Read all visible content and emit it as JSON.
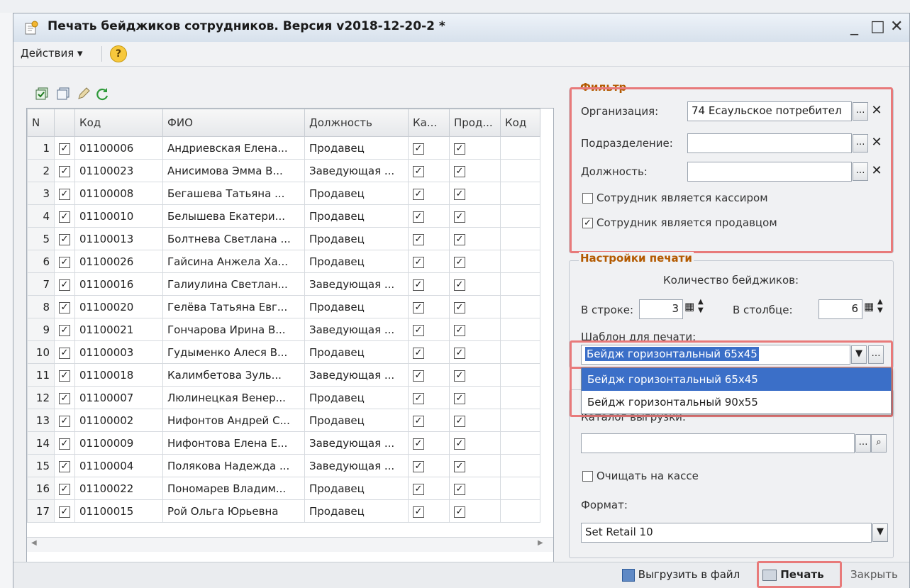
{
  "window": {
    "title": "Печать бейджиков сотрудников. Версия v2018-12-20-2 *",
    "minimize": "_",
    "maximize": "□",
    "close": "✕"
  },
  "menu": {
    "actions_label": "Действия ▾",
    "help_label": "?"
  },
  "table": {
    "headers": [
      "N",
      "",
      "Код",
      "ФИО",
      "Должность",
      "Ка...",
      "Прод...",
      "Код"
    ],
    "rows": [
      {
        "n": "1",
        "code": "01100006",
        "fio": "Андриевская Елена...",
        "pos": "Продавец"
      },
      {
        "n": "2",
        "code": "01100023",
        "fio": "Анисимова Эмма В...",
        "pos": "Заведующая ..."
      },
      {
        "n": "3",
        "code": "01100008",
        "fio": "Бегашева Татьяна ...",
        "pos": "Продавец"
      },
      {
        "n": "4",
        "code": "01100010",
        "fio": "Белышева Екатери...",
        "pos": "Продавец"
      },
      {
        "n": "5",
        "code": "01100013",
        "fio": "Болтнева Светлана ...",
        "pos": "Продавец"
      },
      {
        "n": "6",
        "code": "01100026",
        "fio": "Гайсина Анжела Ха...",
        "pos": "Продавец"
      },
      {
        "n": "7",
        "code": "01100016",
        "fio": "Галиулина Светлан...",
        "pos": "Заведующая ..."
      },
      {
        "n": "8",
        "code": "01100020",
        "fio": "Гелёва Татьяна Евг...",
        "pos": "Продавец"
      },
      {
        "n": "9",
        "code": "01100021",
        "fio": "Гончарова Ирина В...",
        "pos": "Заведующая ..."
      },
      {
        "n": "10",
        "code": "01100003",
        "fio": "Гудыменко Алеся В...",
        "pos": "Продавец"
      },
      {
        "n": "11",
        "code": "01100018",
        "fio": "Калимбетова Зуль...",
        "pos": "Заведующая ..."
      },
      {
        "n": "12",
        "code": "01100007",
        "fio": "Люлинецкая Венер...",
        "pos": "Продавец"
      },
      {
        "n": "13",
        "code": "01100002",
        "fio": "Нифонтов Андрей С...",
        "pos": "Продавец"
      },
      {
        "n": "14",
        "code": "01100009",
        "fio": "Нифонтова Елена Е...",
        "pos": "Заведующая ..."
      },
      {
        "n": "15",
        "code": "01100004",
        "fio": "Полякова Надежда ...",
        "pos": "Заведующая ..."
      },
      {
        "n": "16",
        "code": "01100022",
        "fio": "Пономарев Владим...",
        "pos": "Продавец"
      },
      {
        "n": "17",
        "code": "01100015",
        "fio": "Рой Ольга Юрьевна",
        "pos": "Продавец"
      }
    ],
    "check_mark": "✓"
  },
  "filter": {
    "title": "Фильтр",
    "org_label": "Организация:",
    "org_value": "74 Есаульское потребител",
    "dept_label": "Подразделение:",
    "dept_value": "",
    "position_label": "Должность:",
    "position_value": "",
    "cashier_label": "Сотрудник является кассиром",
    "seller_label": "Сотрудник является продавцом"
  },
  "print": {
    "title": "Настройки печати",
    "count_label": "Количество бейджиков:",
    "row_label": "В строке:",
    "row_value": "3",
    "col_label": "В столбце:",
    "col_value": "6",
    "template_label": "Шаблон для печати:",
    "template_value": "Бейдж горизонтальный 65х45",
    "options": [
      "Бейдж горизонтальный 65х45",
      "Бейдж горизонтальный 90х55"
    ]
  },
  "export": {
    "catalog_label": "Каталог выгрузки:",
    "catalog_value": "",
    "clear_label": "Очищать на кассе",
    "format_label": "Формат:",
    "format_value": "Set Retail 10"
  },
  "bottom": {
    "export_button": "Выгрузить в файл",
    "print_button": "Печать",
    "close_button": "Закрыть"
  }
}
